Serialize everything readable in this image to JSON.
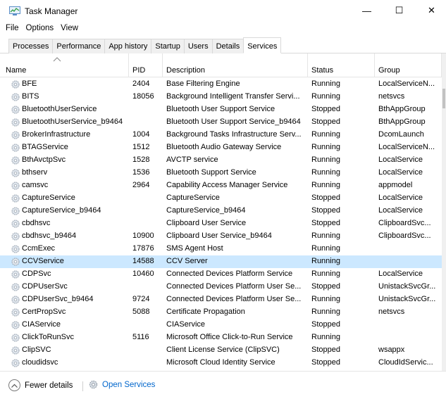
{
  "window": {
    "title": "Task Manager",
    "minimize_glyph": "—",
    "maximize_glyph": "☐",
    "close_glyph": "✕"
  },
  "menu": [
    "File",
    "Options",
    "View"
  ],
  "tabs": [
    {
      "label": "Processes",
      "active": false
    },
    {
      "label": "Performance",
      "active": false
    },
    {
      "label": "App history",
      "active": false
    },
    {
      "label": "Startup",
      "active": false
    },
    {
      "label": "Users",
      "active": false
    },
    {
      "label": "Details",
      "active": false
    },
    {
      "label": "Services",
      "active": true
    }
  ],
  "columns": {
    "name": "Name",
    "pid": "PID",
    "description": "Description",
    "status": "Status",
    "group": "Group"
  },
  "services": [
    {
      "name": "BFE",
      "pid": "2404",
      "description": "Base Filtering Engine",
      "status": "Running",
      "group": "LocalServiceN..."
    },
    {
      "name": "BITS",
      "pid": "18056",
      "description": "Background Intelligent Transfer Servi...",
      "status": "Running",
      "group": "netsvcs"
    },
    {
      "name": "BluetoothUserService",
      "pid": "",
      "description": "Bluetooth User Support Service",
      "status": "Stopped",
      "group": "BthAppGroup"
    },
    {
      "name": "BluetoothUserService_b9464",
      "pid": "",
      "description": "Bluetooth User Support Service_b9464",
      "status": "Stopped",
      "group": "BthAppGroup"
    },
    {
      "name": "BrokerInfrastructure",
      "pid": "1004",
      "description": "Background Tasks Infrastructure Serv...",
      "status": "Running",
      "group": "DcomLaunch"
    },
    {
      "name": "BTAGService",
      "pid": "1512",
      "description": "Bluetooth Audio Gateway Service",
      "status": "Running",
      "group": "LocalServiceN..."
    },
    {
      "name": "BthAvctpSvc",
      "pid": "1528",
      "description": "AVCTP service",
      "status": "Running",
      "group": "LocalService"
    },
    {
      "name": "bthserv",
      "pid": "1536",
      "description": "Bluetooth Support Service",
      "status": "Running",
      "group": "LocalService"
    },
    {
      "name": "camsvc",
      "pid": "2964",
      "description": "Capability Access Manager Service",
      "status": "Running",
      "group": "appmodel"
    },
    {
      "name": "CaptureService",
      "pid": "",
      "description": "CaptureService",
      "status": "Stopped",
      "group": "LocalService"
    },
    {
      "name": "CaptureService_b9464",
      "pid": "",
      "description": "CaptureService_b9464",
      "status": "Stopped",
      "group": "LocalService"
    },
    {
      "name": "cbdhsvc",
      "pid": "",
      "description": "Clipboard User Service",
      "status": "Stopped",
      "group": "ClipboardSvc..."
    },
    {
      "name": "cbdhsvc_b9464",
      "pid": "10900",
      "description": "Clipboard User Service_b9464",
      "status": "Running",
      "group": "ClipboardSvc..."
    },
    {
      "name": "CcmExec",
      "pid": "17876",
      "description": "SMS Agent Host",
      "status": "Running",
      "group": ""
    },
    {
      "name": "CCVService",
      "pid": "14588",
      "description": "CCV Server",
      "status": "Running",
      "group": "",
      "selected": true
    },
    {
      "name": "CDPSvc",
      "pid": "10460",
      "description": "Connected Devices Platform Service",
      "status": "Running",
      "group": "LocalService"
    },
    {
      "name": "CDPUserSvc",
      "pid": "",
      "description": "Connected Devices Platform User Se...",
      "status": "Stopped",
      "group": "UnistackSvcGr..."
    },
    {
      "name": "CDPUserSvc_b9464",
      "pid": "9724",
      "description": "Connected Devices Platform User Se...",
      "status": "Running",
      "group": "UnistackSvcGr..."
    },
    {
      "name": "CertPropSvc",
      "pid": "5088",
      "description": "Certificate Propagation",
      "status": "Running",
      "group": "netsvcs"
    },
    {
      "name": "CIAService",
      "pid": "",
      "description": "CIAService",
      "status": "Stopped",
      "group": ""
    },
    {
      "name": "ClickToRunSvc",
      "pid": "5116",
      "description": "Microsoft Office Click-to-Run Service",
      "status": "Running",
      "group": ""
    },
    {
      "name": "ClipSVC",
      "pid": "",
      "description": "Client License Service (ClipSVC)",
      "status": "Stopped",
      "group": "wsappx"
    },
    {
      "name": "cloudidsvc",
      "pid": "",
      "description": "Microsoft Cloud Identity Service",
      "status": "Stopped",
      "group": "CloudIdServic..."
    }
  ],
  "footer": {
    "fewer_details": "Fewer details",
    "open_services": "Open Services"
  },
  "colors": {
    "selected_row": "#cce8ff",
    "link": "#0066cc"
  }
}
